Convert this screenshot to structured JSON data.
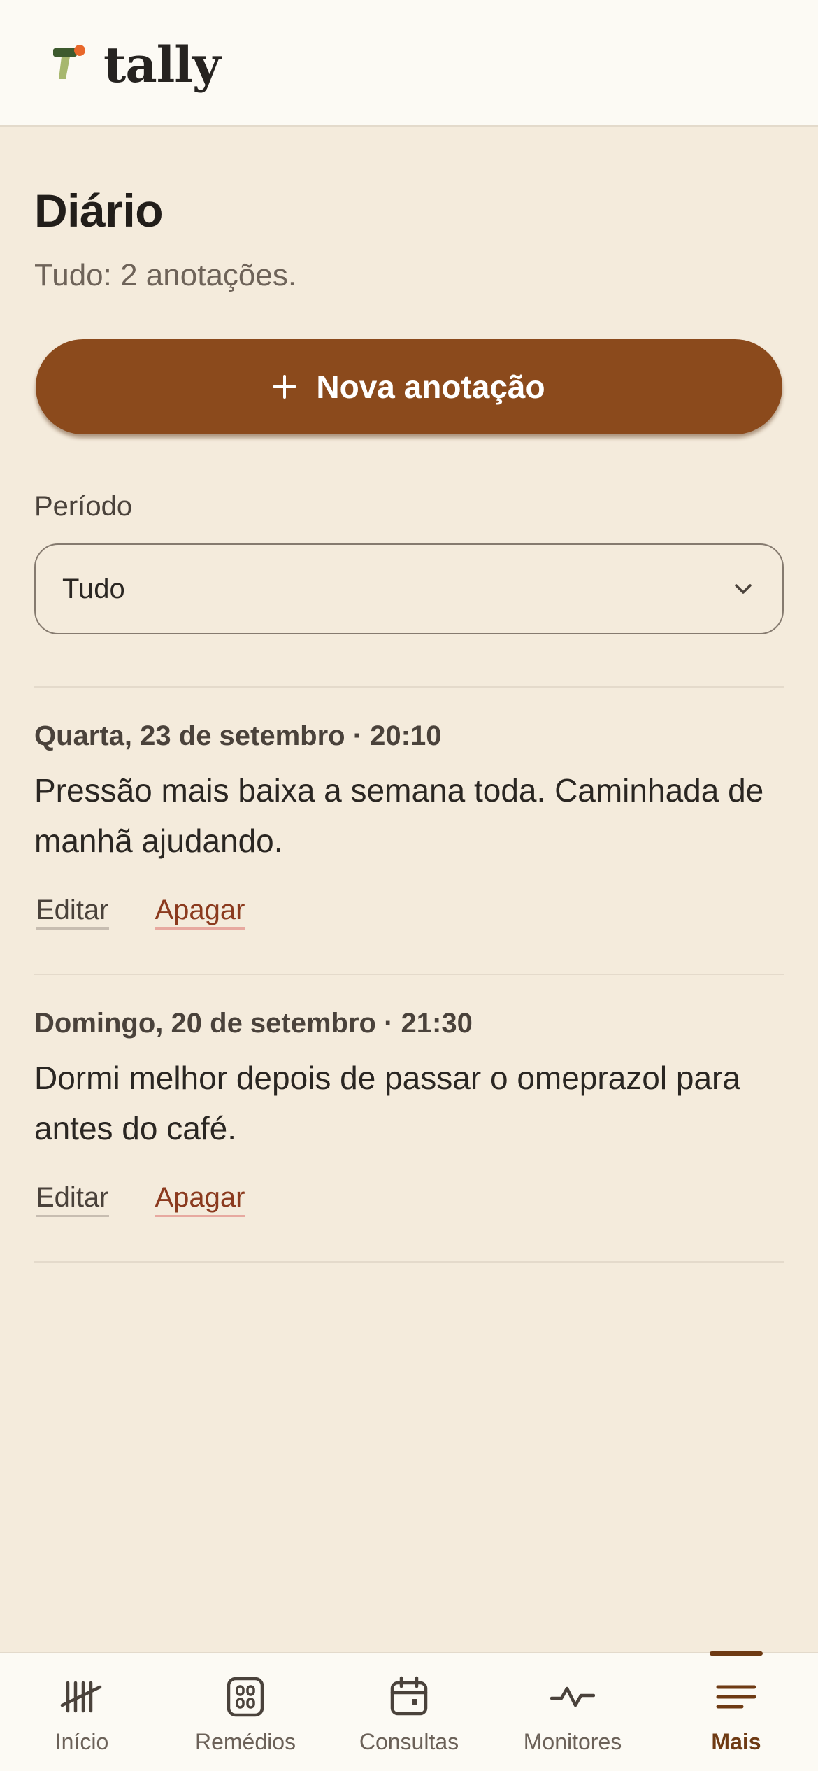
{
  "app": {
    "name": "tally"
  },
  "page": {
    "title": "Diário",
    "subtitle": "Tudo: 2 anotações.",
    "new_button_label": "Nova anotação"
  },
  "filter": {
    "label": "Período",
    "selected": "Tudo"
  },
  "entries": [
    {
      "date": "Quarta, 23 de setembro · 20:10",
      "text": "Pressão mais baixa a semana toda. Caminhada de manhã ajudando.",
      "edit_label": "Editar",
      "delete_label": "Apagar"
    },
    {
      "date": "Domingo, 20 de setembro · 21:30",
      "text": "Dormi melhor depois de passar o omeprazol para antes do café.",
      "edit_label": "Editar",
      "delete_label": "Apagar"
    }
  ],
  "tabbar": {
    "items": [
      {
        "label": "Início",
        "icon": "tally-marks-icon"
      },
      {
        "label": "Remédios",
        "icon": "pill-box-icon"
      },
      {
        "label": "Consultas",
        "icon": "calendar-icon"
      },
      {
        "label": "Monitores",
        "icon": "pulse-icon"
      },
      {
        "label": "Mais",
        "icon": "menu-icon",
        "active": true
      }
    ]
  },
  "colors": {
    "background": "#F4EBDC",
    "header": "#FCFAF4",
    "accent": "#8B4A1C",
    "danger_link": "#8B3A1E",
    "logo_green_dark": "#3D5A2E",
    "logo_green_light": "#A7B76E",
    "logo_orange": "#E8672A"
  }
}
